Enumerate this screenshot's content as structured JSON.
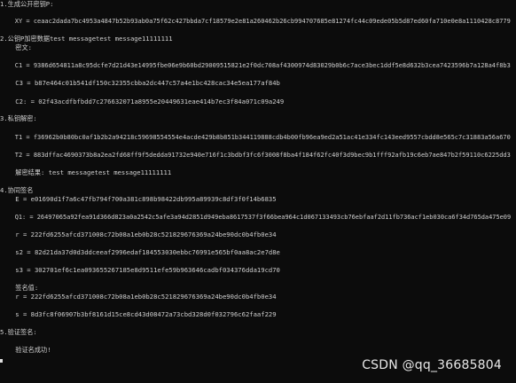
{
  "console": {
    "lines": {
      "l1": "1.生成公开密钥P:",
      "l2": "    XY = ceaac2dada7bc4953a4847b52b93ab0a75f62c427bbda7cf18579e2e81a260462b26cb994707685e81274fc44c09ede05b5d87ed60fa710e0e8a1110428c8779",
      "l3": "2.公钥P加密数据test messagetest message11111111",
      "l4": "    密文:",
      "l5": "    C1 = 9386d654811a8c95dcfe7d21d43e14995fbe06e9b60bd29009515821e2f0dc708af4300974d83029b0b6c7ace3bec1ddf5e8d632b3cea7423596b7a128a4f8b3",
      "l6": "    C3 = b87e464c01b541df150c32355cbba2dc447c57a4e1bc428cac34e5ea177af84b",
      "l7": "    C2: = 02f43acdfbfbdd7c276632071a8955e20449631eae414b7ec3f84a071c09a249",
      "l8": "3.私钥解密:",
      "l9": "    T1 = f36962b0b80bc0af1b2b2a94218c59698554554e4acde429b8b851b344119888cdb4b00fb96ea9ed2a51ac41e334fc143eed9557cbdd8e565c7c31883a56a670",
      "l10": "    T2 = 883dffac4690373b8a2ea2fd68ff9f5dedda91732e940e716f1c3bdbf3fc6f3008f8ba4f184f62fc40f3d9bec9b1fff92afb19c6eb7ae847b2f59110c6225dd3",
      "l11": "    解密结果: test messagetest message11111111",
      "l12": "4.协同签名",
      "l13": "    E = e01690d1f7a6c47fb794f700a381c898b98422db995a89939c8df3f0f14b6835",
      "l14": "    Q1: = 26497065a92fea91d366d823a0a2542c5afe3a94d2851d949eba8617537f3f66bea964c1d067133493cb76ebfaaf2d11fb736acf1eb030ca6f34d765da475e09",
      "l15": "    r = 222fd6255afcd371008c72b08a1eb0b28c521829676369a24be90dc0b4fb0e34",
      "l16": "    s2 = 82d21da37d0d3ddceeaf2996edaf184553030ebbc76991e565bf0aa8ac2e7d8e",
      "l17": "    s3 = 302701ef6c1ea093655267185e8d9511efe59b963646cadbf034376dda19cd70",
      "l18": "    签名值:",
      "l19": "    r = 222fd6255afcd371008c72b08a1eb0b28c521829676369a24be90dc0b4fb0e34",
      "l20": "    s = 8d3fc8f06907b3bf8161d15ce8cd43d08472a73cbd328d0f032796c62faaf229",
      "l21": "5.验证签名:",
      "l22": "    验证名成功!"
    }
  },
  "watermark": {
    "text": "CSDN @qq_36685804"
  }
}
